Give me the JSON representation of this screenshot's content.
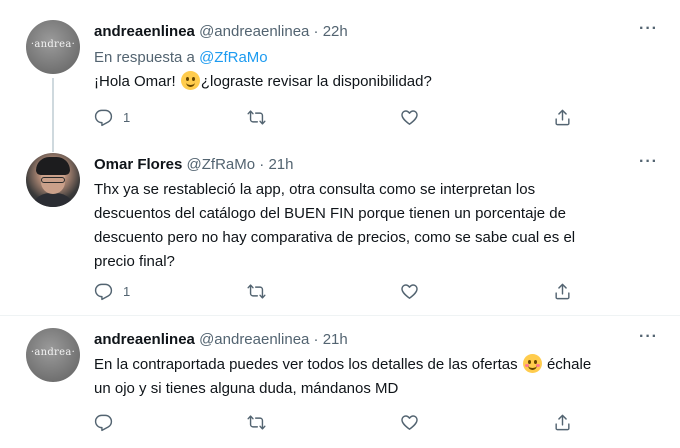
{
  "tweets": [
    {
      "display_name": "andreaenlinea",
      "handle": "@andreaenlinea",
      "time": "· 22h",
      "avatar_text": "·andrea·",
      "reply_prefix": "En respuesta a",
      "reply_handle": "@ZfRaMo",
      "text_before_emoji": "¡Hola Omar!",
      "text_after_emoji": "¿lograste revisar la disponibilidad?",
      "emoji_icon": "slightly-smiling-face-emoji",
      "reply_count": "1"
    },
    {
      "display_name": "Omar Flores",
      "handle": "@ZfRaMo",
      "time": "· 21h",
      "lines": [
        "Thx ya se restableció la app, otra consulta como se interpretan los",
        "descuentos del catálogo del BUEN FIN porque tienen un porcentaje de",
        "descuento pero no hay comparativa de precios, como se sabe cual es el",
        "precio final?"
      ],
      "reply_count": "1"
    },
    {
      "display_name": "andreaenlinea",
      "handle": "@andreaenlinea",
      "time": "· 21h",
      "avatar_text": "·andrea·",
      "line1_before_emoji": "En la contraportada puedes ver todos los detalles de las ofertas",
      "line1_after_emoji": "échale",
      "line2": "un ojo y si tienes alguna duda, mándanos MD",
      "emoji_icon": "smiling-face-with-smiling-eyes-emoji",
      "reply_count": ""
    }
  ],
  "more_label": "···",
  "colors": {
    "link": "#1d9bf0",
    "muted": "#536471",
    "text": "#0f1419",
    "thread_line": "#cfd9de"
  }
}
